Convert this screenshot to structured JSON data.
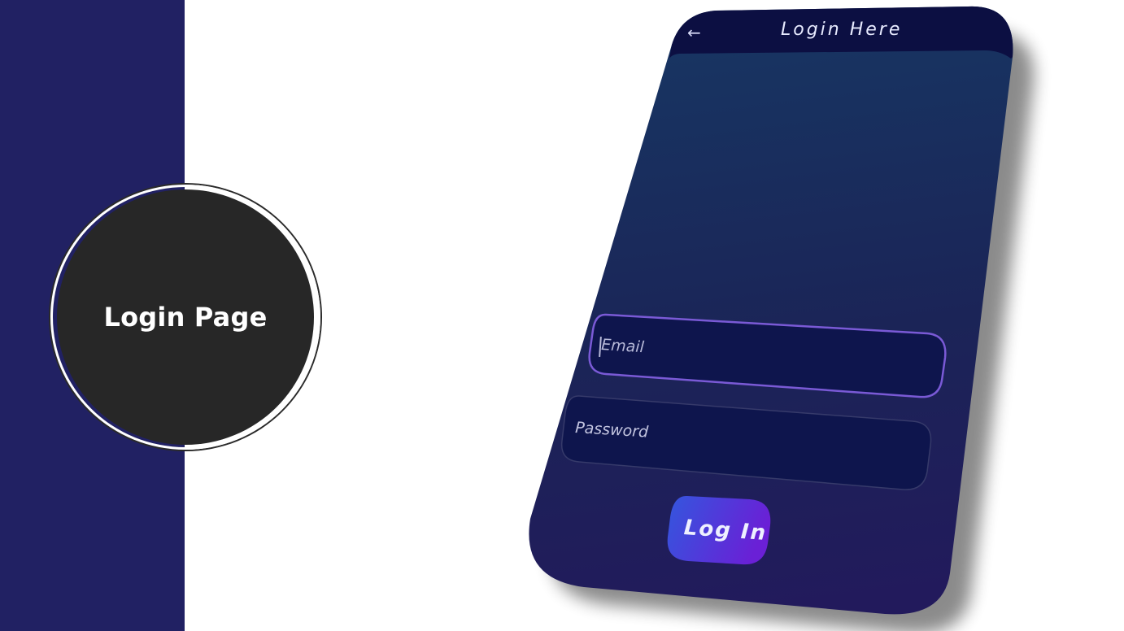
{
  "badge": {
    "title": "Login Page"
  },
  "phone": {
    "header": {
      "title": "Login Here",
      "back_icon": "arrow-left-icon"
    },
    "form": {
      "email_placeholder": "Email",
      "password_placeholder": "Password",
      "submit_label": "Log In"
    }
  },
  "colors": {
    "sidebar": "#212163",
    "badge": "#272727",
    "header": "#0c0f42",
    "screen_top": "#173663",
    "screen_bottom": "#221a5c",
    "input_fill": "#0e154d",
    "input_focus_border": "#7a5ad6",
    "button_start": "#3357de",
    "button_end": "#6a20d6"
  }
}
